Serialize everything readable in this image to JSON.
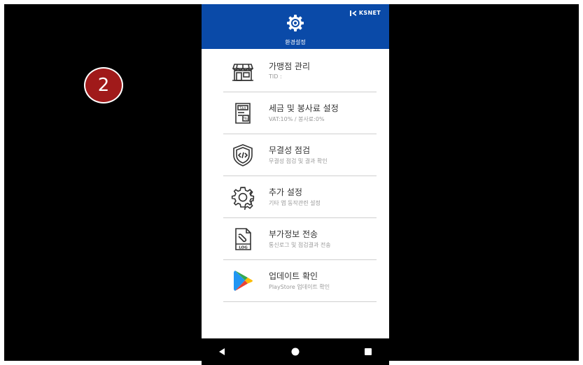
{
  "step_badge": "2",
  "header": {
    "title": "환경설정",
    "brand": "KSNET",
    "bg_color": "#0a4aa8"
  },
  "menu": [
    {
      "icon": "store-icon",
      "label": "가맹점 관리",
      "sub": "TID :"
    },
    {
      "icon": "tax-document-icon",
      "label": "세금 및 봉사료 설정",
      "sub": "VAT:10% / 봉사료:0%"
    },
    {
      "icon": "shield-code-icon",
      "label": "무결성 점검",
      "sub": "무결성 점검 및 결과 확인"
    },
    {
      "icon": "gear-icon",
      "label": "추가 설정",
      "sub": "기타 앱 동작관련 설정"
    },
    {
      "icon": "log-file-icon",
      "label": "부가정보 전송",
      "sub": "통신로그 및 점검결과 전송"
    },
    {
      "icon": "play-store-icon",
      "label": "업데이트 확인",
      "sub": "PlayStore 업데이트 확인"
    }
  ],
  "navbar": {
    "icons": [
      "back-icon",
      "home-icon",
      "recent-apps-icon"
    ]
  }
}
